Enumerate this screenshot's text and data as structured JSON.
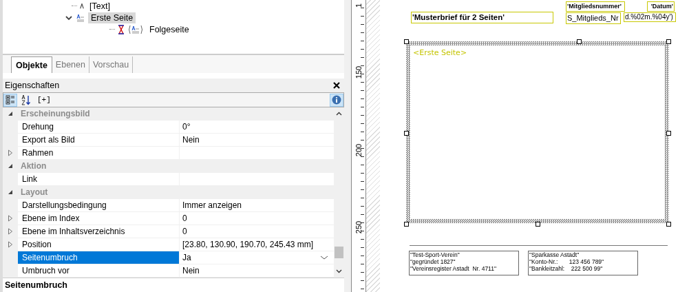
{
  "tree": [
    {
      "label": "[Text]",
      "kind": "text",
      "selected": false
    },
    {
      "label": "Erste Seite",
      "kind": "page",
      "selected": true,
      "expanded": true,
      "children": [
        {
          "label": "Folgeseite",
          "kind": "followup",
          "selected": false
        }
      ]
    }
  ],
  "tabs": [
    {
      "label": "Objekte",
      "selected": true
    },
    {
      "label": "Ebenen",
      "selected": false
    },
    {
      "label": "Vorschau",
      "selected": false
    }
  ],
  "properties_panel": {
    "title": "Eigenschaften",
    "toolbar": [
      {
        "kind": "categorized",
        "selected": true
      },
      {
        "kind": "sort",
        "selected": false
      },
      {
        "kind": "text",
        "label": "[+]",
        "selected": false
      },
      {
        "kind": "info",
        "selected": true
      }
    ]
  },
  "groups": [
    {
      "name": "Erscheinungsbild",
      "expanded": true,
      "properties": [
        {
          "name": "Drehung",
          "value": "0°",
          "expandable": false,
          "selected": false
        },
        {
          "name": "Export als Bild",
          "value": "Nein",
          "expandable": false,
          "selected": false
        },
        {
          "name": "Rahmen",
          "expandable": true,
          "selected": false
        }
      ]
    },
    {
      "name": "Aktion",
      "expanded": true,
      "properties": [
        {
          "name": "Link",
          "expandable": false,
          "selected": false
        }
      ]
    },
    {
      "name": "Layout",
      "expanded": true,
      "properties": [
        {
          "name": "Darstellungsbedingung",
          "value": "Immer anzeigen",
          "expandable": false,
          "selected": false
        },
        {
          "name": "Ebene im Index",
          "value": "0",
          "expandable": true,
          "selected": false
        },
        {
          "name": "Ebene im Inhaltsverzeichnis",
          "value": "0",
          "expandable": true,
          "selected": false
        },
        {
          "name": "Position",
          "value": "[23.80, 130.90, 190.70, 245.43 mm]",
          "expandable": true,
          "selected": false
        },
        {
          "name": "Seitenumbruch",
          "value": "Ja",
          "expandable": false,
          "selected": true
        },
        {
          "name": "Umbruch vor",
          "value": "Nein",
          "expandable": false,
          "selected": false
        }
      ]
    }
  ],
  "description": {
    "title": "Seitenumbruch"
  },
  "ruler": {
    "labels": [
      "1",
      "150",
      "200",
      "250"
    ]
  },
  "document": {
    "title_field": "'Musterbrief für 2 Seiten'",
    "member_label": "'Mitgliedsnummer'",
    "member_value": "S_Mitglieds_Nr",
    "date_label": "'Datum'",
    "date_value": "d.%02m.%04y')",
    "frame_label": "<Erste Seite>",
    "footer_boxes": [
      [
        "\"Test-Sport-Verein\"",
        "\"gegründet 1827\"",
        "\"Vereinsregister Astadt  Nr. 4711\""
      ],
      [
        "\"Sparkasse Astadt\"",
        "\"Konto-Nr.:       123 456 789\"",
        "\"Bankleitzahl:    222 500 99\""
      ]
    ]
  }
}
